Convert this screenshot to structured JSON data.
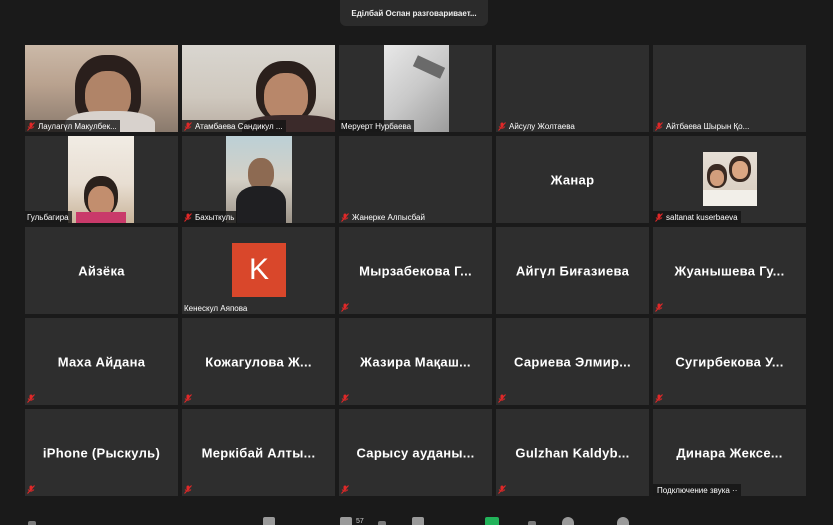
{
  "speaker_banner": "Еділбай Оспан разговаривает...",
  "colors": {
    "background": "#1a1a1a",
    "tile": "#2e2e2e",
    "mute_red": "#e02828",
    "avatar_orange": "#d9472b"
  },
  "tiles": [
    {
      "label": "Лаулагүл Макулбек...",
      "video": true,
      "muted": true
    },
    {
      "label": "Атамбаева Сандикул ...",
      "video": true,
      "muted": true
    },
    {
      "label": "Меруерт Нурбаева",
      "video": true,
      "muted": false
    },
    {
      "label": "Айсулу Жолтаева",
      "video": false,
      "muted": true
    },
    {
      "label": "Айтбаева Шырын Қо...",
      "video": false,
      "muted": true
    },
    {
      "label": "Гульбагира",
      "video": true,
      "muted": false
    },
    {
      "label": "Бахыткуль",
      "video": true,
      "muted": true
    },
    {
      "label": "Жанерке Алпысбай",
      "video": false,
      "muted": true
    },
    {
      "center": "Жанар",
      "video": false,
      "muted": false
    },
    {
      "label": "saltanat kuserbaeva",
      "video": true,
      "muted": true
    },
    {
      "center": "Айзёка",
      "video": false,
      "muted": false
    },
    {
      "label": "Кенескул Аяпова",
      "avatar_letter": "K",
      "video": false,
      "muted": false
    },
    {
      "center": "Мырзабекова Г...",
      "video": false,
      "muted": true
    },
    {
      "center": "Айгүл Биғазиева",
      "video": false,
      "muted": false
    },
    {
      "center": "Жуанышева Гу...",
      "video": false,
      "muted": true
    },
    {
      "center": "Маха Айдана",
      "video": false,
      "muted": true
    },
    {
      "center": "Кожагулова Ж...",
      "video": false,
      "muted": true
    },
    {
      "center": "Жазира Мақаш...",
      "video": false,
      "muted": true
    },
    {
      "center": "Сариева Элмир...",
      "video": false,
      "muted": true
    },
    {
      "center": "Сугирбекова У...",
      "video": false,
      "muted": true
    },
    {
      "center": "iPhone (Рыскуль)",
      "video": false,
      "muted": true
    },
    {
      "center": "Меркібай Алты...",
      "video": false,
      "muted": true
    },
    {
      "center": "Сарысу ауданы...",
      "video": false,
      "muted": true
    },
    {
      "center": "Gulzhan Kaldyb...",
      "video": false,
      "muted": true
    },
    {
      "center": "Динара Жексе...",
      "status": "Подключение звука ··",
      "video": false,
      "muted": false
    }
  ],
  "toolbar": {
    "participants_count": "57"
  }
}
